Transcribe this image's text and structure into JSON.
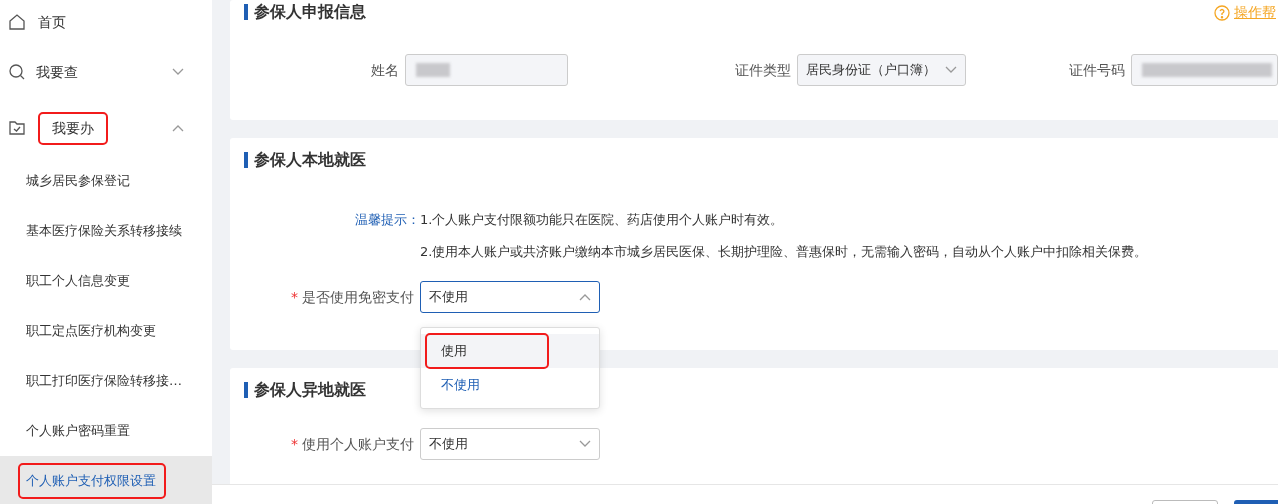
{
  "sidebar": {
    "items": [
      {
        "label": "首页",
        "highlighted": false
      },
      {
        "label": "我要查",
        "expanded": false,
        "highlighted": false
      },
      {
        "label": "我要办",
        "expanded": true,
        "highlighted": true,
        "children": [
          {
            "label": "城乡居民参保登记",
            "selected": false,
            "highlighted": false
          },
          {
            "label": "基本医疗保险关系转移接续",
            "selected": false,
            "highlighted": false
          },
          {
            "label": "职工个人信息变更",
            "selected": false,
            "highlighted": false
          },
          {
            "label": "职工定点医疗机构变更",
            "selected": false,
            "highlighted": false
          },
          {
            "label": "职工打印医疗保险转移接…",
            "selected": false,
            "highlighted": false
          },
          {
            "label": "个人账户密码重置",
            "selected": false,
            "highlighted": false
          },
          {
            "label": "个人账户支付权限设置",
            "selected": true,
            "highlighted": true
          }
        ]
      }
    ]
  },
  "help_link": "操作帮",
  "sections": [
    {
      "title": "参保人申报信息",
      "fields": [
        {
          "label": "姓名",
          "kind": "redacted"
        },
        {
          "label": "证件类型",
          "kind": "select",
          "value": "居民身份证（户口簿）",
          "open": false
        },
        {
          "label": "证件号码",
          "kind": "redacted"
        }
      ]
    },
    {
      "title": "参保人本地就医",
      "notice": {
        "label": "温馨提示：",
        "lines": [
          "1.个人账户支付限额功能只在医院、药店使用个人账户时有效。",
          "2.使用本人账户或共济账户缴纳本市城乡居民医保、长期护理险、普惠保时，无需输入密码，自动从个人账户中扣除相关保费。"
        ]
      },
      "fields": [
        {
          "label": "是否使用免密支付",
          "kind": "select",
          "value": "不使用",
          "required_mark": "*",
          "open": true,
          "options": [
            {
              "label": "使用",
              "selected": false,
              "hovered": true,
              "highlighted": true
            },
            {
              "label": "不使用",
              "selected": true,
              "hovered": false,
              "highlighted": false
            }
          ]
        }
      ]
    },
    {
      "title": "参保人异地就医",
      "fields": [
        {
          "label": "使用个人账户支付",
          "kind": "select",
          "value": "不使用",
          "required_mark": "*",
          "open": false
        }
      ]
    }
  ]
}
